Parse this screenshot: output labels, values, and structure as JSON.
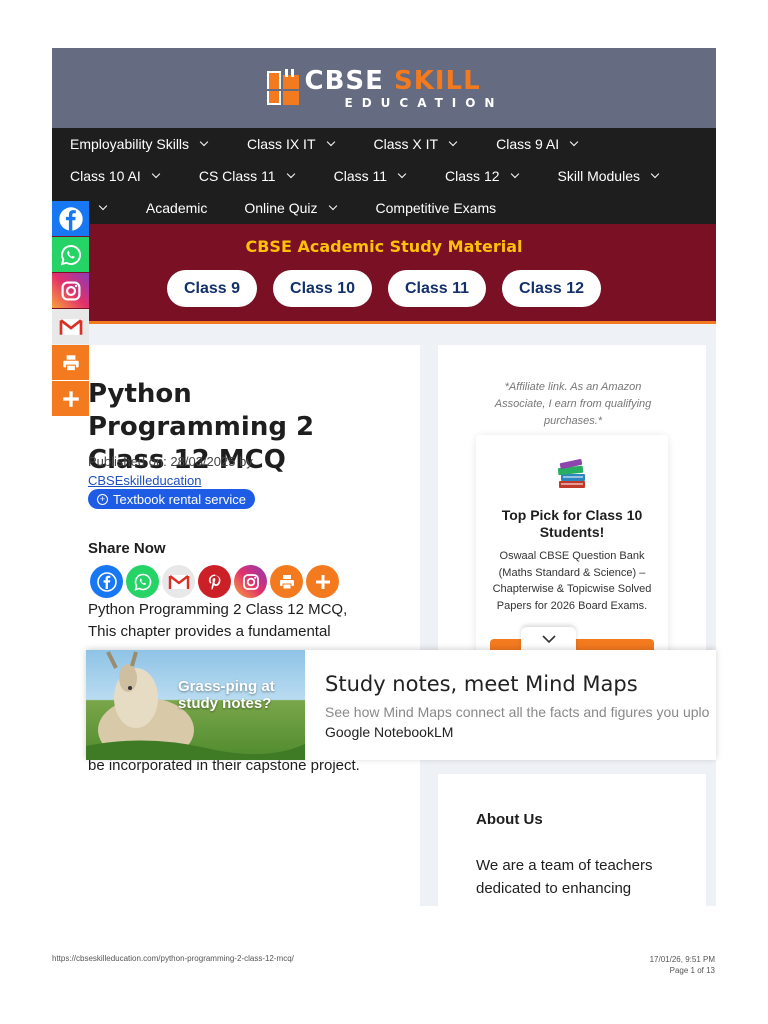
{
  "site": {
    "logo_primary": "CBSE",
    "logo_accent": "SKILL",
    "logo_sub": "EDUCATION",
    "brand_color": "#f47a1f",
    "nav_rows": [
      [
        {
          "label": "Employability Skills",
          "has_dropdown": true
        },
        {
          "label": "Class IX IT",
          "has_dropdown": true
        },
        {
          "label": "Class X IT",
          "has_dropdown": true
        },
        {
          "label": "Class 9 AI",
          "has_dropdown": true
        }
      ],
      [
        {
          "label": "Class 10 AI",
          "has_dropdown": true
        },
        {
          "label": "CS Class 11",
          "has_dropdown": true
        },
        {
          "label": "Class 11",
          "has_dropdown": true
        },
        {
          "label": "Class 12",
          "has_dropdown": true
        },
        {
          "label": "Skill Modules",
          "has_dropdown": true
        }
      ],
      [
        {
          "label": "ols",
          "has_dropdown": true
        },
        {
          "label": "Academic",
          "has_dropdown": false
        },
        {
          "label": "Online Quiz",
          "has_dropdown": true
        },
        {
          "label": "Competitive Exams",
          "has_dropdown": false
        }
      ]
    ],
    "banner": {
      "title": "CBSE Academic Study Material",
      "classes": [
        "Class 9",
        "Class 10",
        "Class 11",
        "Class 12"
      ]
    }
  },
  "article": {
    "title": "Python Programming 2 Class 12 MCQ",
    "published_prefix": "Published on: 28/03/2025 by",
    "author": "CBSEskilleducation",
    "rental_label": "Textbook rental service",
    "share_label": "Share Now",
    "share_icons": [
      "facebook-icon",
      "whatsapp-icon",
      "gmail-icon",
      "pinterest-icon",
      "instagram-icon",
      "print-icon",
      "more-icon"
    ],
    "body_line1": "Python Programming 2 Class 12 MCQ,",
    "body_line2": "This chapter provides a fundamental",
    "body_tail": "be incorporated in their capstone project."
  },
  "sidebar": {
    "affiliate_note": "*Affiliate link. As an Amazon Associate, I earn from qualifying purchases.*",
    "pick_title": "Top Pick for Class 10 Students!",
    "pick_desc": "Oswaal CBSE Question Bank (Maths Standard & Science) – Chapterwise & Topicwise Solved Papers for 2026 Board Exams.",
    "about_title": "About Us",
    "about_text": "We are a team of teachers dedicated to enhancing"
  },
  "floating_share": [
    "facebook-icon",
    "whatsapp-icon",
    "instagram-icon",
    "gmail-icon",
    "print-icon",
    "more-icon"
  ],
  "ad": {
    "image_headline": "Grass-ping at study notes?",
    "title": "Study notes, meet Mind Maps",
    "description": "See how Mind Maps connect all the facts and figures you uplo",
    "brand": "Google NotebookLM"
  },
  "print_footer": {
    "url": "https://cbseskilleducation.com/python-programming-2-class-12-mcq/",
    "datetime": "17/01/26, 9:51 PM",
    "page": "Page 1 of 13"
  }
}
